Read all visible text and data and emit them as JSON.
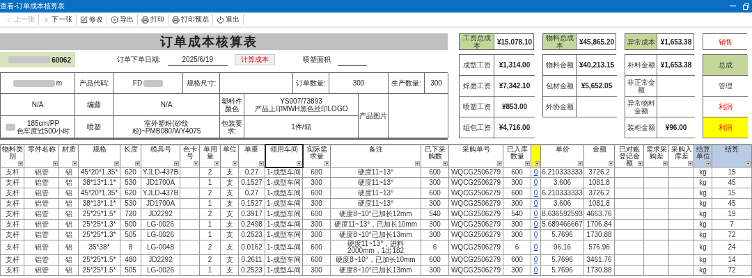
{
  "window": {
    "title": "查看-订单成本核算表"
  },
  "toolbar": [
    {
      "label": "上一张",
      "disabled": true
    },
    {
      "label": "下一张",
      "disabled": false
    },
    {
      "label": "修改",
      "disabled": false
    },
    {
      "label": "导出",
      "disabled": false
    },
    {
      "label": "打印",
      "disabled": false
    },
    {
      "label": "打印预览",
      "disabled": false
    },
    {
      "label": "退出",
      "disabled": false
    }
  ],
  "form": {
    "title": "订单成本核算表",
    "order_no": {
      "text": "60062",
      "redacted": true
    },
    "order_date_label": "订单下单日期:",
    "order_date": "2025/6/19",
    "calc_button": "计算成本",
    "spray_area_label": "喷塑面积"
  },
  "info_cells": [
    {
      "text": "m",
      "redacted": true
    },
    {
      "text": "产品代码:"
    },
    {
      "text": "FD",
      "redacted_after": true
    },
    {
      "text": "规格尺寸:"
    },
    {
      "text": "订单数量:"
    },
    {
      "text": "300"
    },
    {
      "text": "生产数量:"
    },
    {
      "text": "300"
    },
    {
      "text": "N/A"
    },
    {
      "text": "编藤"
    },
    {
      "text": "N/A"
    },
    {
      "text": "塑料件颜色"
    },
    {
      "text": "YS007/73893\n产品上印MWH黑色丝印LOGO"
    },
    {
      "text": "产品图片"
    },
    {
      "text": "185cm/PP\n色牢度过500小时",
      "redacted": true
    },
    {
      "text": "喷塑"
    },
    {
      "text": "室外塑粉(砂纹粉)~PMB080/WY4075"
    },
    {
      "text": "包装要求:"
    },
    {
      "text": "1件/箱"
    }
  ],
  "summaries": [
    {
      "kind": "total",
      "title": "工资总成本",
      "total": "¥15,078.10",
      "rows": [
        {
          "label": "成型工资",
          "value": "¥1,314.00",
          "kind": "plain"
        },
        {
          "label": "焊磨工资",
          "value": "¥7,342.10",
          "kind": "plain"
        },
        {
          "label": "喷塑工资",
          "value": "¥853.00",
          "kind": "plain"
        },
        {
          "label": "组包工资",
          "value": "¥4,716.00",
          "kind": "plain"
        }
      ]
    },
    {
      "kind": "total",
      "title": "物料总成本",
      "total": "¥45,865.20",
      "rows": [
        {
          "label": "物料金额",
          "value": "¥40,213.15",
          "kind": "plain"
        },
        {
          "label": "包材金额",
          "value": "¥5,652.05",
          "kind": "plain"
        },
        {
          "label": "外协金额",
          "kind": "plain"
        }
      ]
    },
    {
      "kind": "total",
      "title": "异常成本",
      "total": "¥1,653.38",
      "rows": [
        {
          "label": "补料金额",
          "value": "¥1,653.38",
          "kind": "plain"
        },
        {
          "label": "非正常金额",
          "kind": "plain"
        },
        {
          "label": "异常物料金额",
          "kind": "plain"
        },
        {
          "label": "装柜金额",
          "value": "¥96.00",
          "kind": "plain"
        }
      ]
    },
    {
      "kind": "partial",
      "title": "销售",
      "rows": [
        {
          "label": "总成",
          "kind": "header"
        },
        {
          "label": "管理",
          "kind": "plain"
        },
        {
          "label": "利润",
          "kind": "alert"
        },
        {
          "label": "利润",
          "kind": "highlight"
        }
      ]
    }
  ],
  "table": {
    "columns": [
      {
        "label": "物料类别",
        "kind": "plain",
        "selected": false
      },
      {
        "label": "零件名称",
        "kind": "plain",
        "selected": false
      },
      {
        "label": "材质",
        "kind": "plain",
        "selected": false
      },
      {
        "label": "规格",
        "kind": "plain",
        "selected": false
      },
      {
        "label": "长度",
        "kind": "plain",
        "selected": false
      },
      {
        "label": "模具号",
        "kind": "plain",
        "selected": false
      },
      {
        "label": "色卡号",
        "kind": "plain",
        "selected": false
      },
      {
        "label": "单用量",
        "kind": "plain",
        "selected": false
      },
      {
        "label": "单位",
        "kind": "plain",
        "selected": false
      },
      {
        "label": "单重",
        "kind": "plain",
        "selected": false
      },
      {
        "label": "领用车间",
        "kind": "plain",
        "selected": true
      },
      {
        "label": "实际需求量",
        "kind": "plain",
        "selected": false
      },
      {
        "label": "备注",
        "kind": "plain",
        "selected": false
      },
      {
        "label": "已下采购数",
        "kind": "plain",
        "selected": false
      },
      {
        "label": "采购单号",
        "kind": "plain",
        "selected": false
      },
      {
        "label": "已入库数量",
        "kind": "plain",
        "selected": false
      },
      {
        "kind": "link",
        "selected": false
      },
      {
        "label": "单价",
        "kind": "plain",
        "selected": false
      },
      {
        "label": "金额",
        "kind": "plain",
        "selected": false
      },
      {
        "label": "已对账登记金额",
        "kind": "plain",
        "selected": false
      },
      {
        "label": "需求采购差",
        "kind": "plain",
        "selected": false
      },
      {
        "label": "采购入库差",
        "kind": "plain",
        "selected": false
      },
      {
        "label": "结算单位",
        "kind": "settlement",
        "selected": false
      },
      {
        "label": "结算",
        "kind": "settlement",
        "selected": false
      }
    ],
    "rows": [
      [
        "支杆",
        "铝管",
        "铝",
        "45*20*1.35*",
        "620",
        "YJLD-437B",
        null,
        "2",
        "支",
        "0.27",
        "1-成型车间",
        "600",
        "硬度11~13°",
        "600",
        "WQCG2506279",
        "600",
        "0",
        "6.210333333",
        "3726.2",
        null,
        null,
        null,
        "kg",
        "15"
      ],
      [
        "支杆",
        "铝管",
        "铝",
        "38*13*1.1*",
        "530",
        "JD1700A",
        null,
        "1",
        "支",
        "0.1527",
        "1-成型车间",
        "300",
        "硬度11~13°",
        "300",
        "WQCG2506279",
        "300",
        "0",
        "3.606",
        "1081.8",
        null,
        null,
        null,
        "kg",
        "45"
      ],
      [
        "支杆",
        "铝管",
        "铝",
        "45*20*1.35*",
        "620",
        "YJLD-437B",
        null,
        "2",
        "支",
        "0.27",
        "1-成型车间",
        "600",
        "硬度11~13°",
        "600",
        "WQCG2506279",
        "600",
        "0",
        "6.210333333",
        "3726.2",
        null,
        null,
        null,
        "kg",
        "15"
      ],
      [
        "支杆",
        "铝管",
        "铝",
        "38*13*1.1*",
        "530",
        "JD1700A",
        null,
        "1",
        "支",
        "0.1527",
        "1-成型车间",
        "300",
        "硬度11~13°",
        "300",
        "WQCG2506279",
        "300",
        "0",
        "3.606",
        "1081.8",
        null,
        null,
        null,
        "kg",
        "45"
      ],
      [
        "支杆",
        "铝管",
        "铝",
        "25*25*1.5*",
        "720",
        "JD2292",
        null,
        "2",
        "支",
        "0.3917",
        "1-成型车间",
        "600",
        "硬度8~10°已加长12mm",
        "540",
        "WQCG2506279",
        "540",
        "0",
        "8.636592593",
        "4663.76",
        null,
        null,
        null,
        "kg",
        "19"
      ],
      [
        "支杆",
        "铝管",
        "铝",
        "25*25*1.3*",
        "500",
        "LG-0026",
        null,
        "1",
        "支",
        "0.2498",
        "1-成型车间",
        "300",
        "硬度11~13°，已加长10mm",
        "300",
        "WQCG2506279",
        "300",
        "0",
        "5.689466667",
        "1706.84",
        null,
        null,
        null,
        "kg",
        "7"
      ],
      [
        "支杆",
        "铝管",
        "铝",
        "25*25*1.3*",
        "505",
        "LG-0026",
        null,
        "1",
        "支",
        "0.2523",
        "1-成型车间",
        "300",
        "硬度8~10°已加长13mm",
        "300",
        "WQCG2506279",
        "300",
        "0",
        "5.7696",
        "1730.88",
        null,
        null,
        null,
        "kg",
        "72"
      ],
      [
        "支杆",
        "铝管",
        "铝",
        "35*38*",
        "8",
        "LG-0048",
        null,
        "2",
        "支",
        "0.0162",
        "1-成型车间",
        "600",
        "硬度11~13°，进料2000mm，1出182",
        "6",
        "WQCG2506279",
        "6",
        "0",
        "96.16",
        "576.96",
        null,
        null,
        null,
        "kg",
        "24"
      ],
      [
        "支杆",
        "铝管",
        "铝",
        "25*25*1.5*",
        "480",
        "JD2292",
        null,
        "2",
        "支",
        "0.2611",
        "1-成型车间",
        "600",
        "硬度8~10°，已加长10mm",
        "600",
        "WQCG2506279",
        "600",
        "0",
        "5.7696",
        "3461.76",
        null,
        null,
        null,
        "kg",
        "14"
      ],
      [
        "支杆",
        "铝管",
        "铝",
        "25*25*1.5*",
        "505",
        "LG-0026",
        null,
        "1",
        "支",
        "0.2523",
        "1-成型车间",
        "300",
        "硬度8~10°已加长13mm",
        "300",
        "WQCG2506279",
        "300",
        "0",
        "5.7696",
        "1730.88",
        null,
        null,
        null,
        "kg",
        "72"
      ]
    ]
  }
}
